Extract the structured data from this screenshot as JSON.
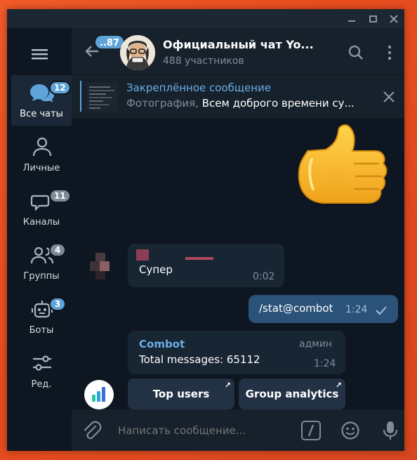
{
  "sidebar": {
    "folders": [
      {
        "label": "Все чаты",
        "badge": "12",
        "icon": "chats-icon"
      },
      {
        "label": "Личные",
        "badge": "",
        "icon": "person-icon"
      },
      {
        "label": "Каналы",
        "badge": "11",
        "icon": "channel-icon"
      },
      {
        "label": "Группы",
        "badge": "4",
        "icon": "group-icon"
      },
      {
        "label": "Боты",
        "badge": "3",
        "icon": "bot-icon"
      },
      {
        "label": "Ред.",
        "badge": "",
        "icon": "sliders-icon"
      }
    ]
  },
  "header": {
    "back_badge": "..87",
    "title": "Официальный чат Yo...",
    "subtitle": "488 участников"
  },
  "pinned": {
    "title": "Закреплённое сообщение",
    "media_type": "Фотография,",
    "preview": "Всем доброго времени су..."
  },
  "messages": [
    {
      "type": "sticker",
      "emoji": "👍"
    },
    {
      "type": "incoming",
      "text": "Супер",
      "time": "0:02"
    },
    {
      "type": "outgoing",
      "text": "/stat@combot",
      "time": "1:24",
      "status": "sent-check"
    },
    {
      "type": "incoming",
      "sender": "Combot",
      "role": "админ",
      "text": "Total messages: 65112",
      "time": "1:24"
    }
  ],
  "inline_keyboard": [
    "Top users",
    "Group analytics"
  ],
  "composer": {
    "placeholder": "Написать сообщение..."
  },
  "colors": {
    "accent": "#5fa4d8",
    "link": "#69aee8",
    "bubble_out": "#2b5278",
    "bubble_in": "#182533",
    "background": "#0e1621"
  }
}
